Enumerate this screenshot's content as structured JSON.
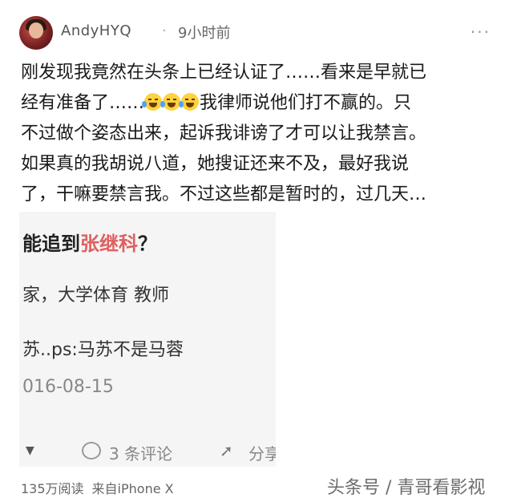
{
  "header": {
    "username": "AndyHYQ",
    "separator": "·",
    "time": "9小时前",
    "more": "···"
  },
  "post": {
    "lines": [
      "刚发现我竟然在头条上已经认证了……看来是早就已",
      "经有准备了……",
      "我律师说他们打不赢的。只",
      "不过做个姿态出来，起诉我诽谤了才可以让我禁言。",
      "如果真的我胡说八道，她搜证还来不及，最好我说",
      "了，干嘛要禁言我。不过这些都是暂时的，过几天…"
    ],
    "emoji_name": "crying-laughing-icon"
  },
  "screenshot": {
    "line1_prefix": "能追到",
    "line1_name": "张继科",
    "line1_suffix": "？",
    "line2": "家，大学体育 教师",
    "line3": "苏..ps:马苏不是马蓉",
    "line4": "016-08-15",
    "comment_text": "3 条评论",
    "share_text": "分享",
    "name_color": "#e06060"
  },
  "footer": {
    "reads": "135万阅读",
    "source": "来自iPhone X",
    "watermark": "头条号 / 青哥看影视"
  }
}
